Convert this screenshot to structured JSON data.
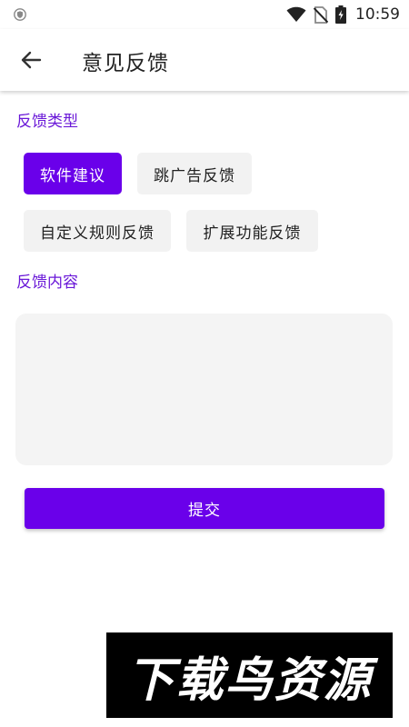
{
  "status_bar": {
    "time": "10:59",
    "icons": [
      "shield-icon",
      "wifi-icon",
      "no-sim-icon",
      "battery-charging-icon"
    ]
  },
  "app_bar": {
    "back_icon": "arrow-left-icon",
    "title": "意见反馈"
  },
  "feedback_type": {
    "label": "反馈类型",
    "options": [
      {
        "label": "软件建议",
        "selected": true
      },
      {
        "label": "跳广告反馈",
        "selected": false
      },
      {
        "label": "自定义规则反馈",
        "selected": false
      },
      {
        "label": "扩展功能反馈",
        "selected": false
      }
    ]
  },
  "feedback_content": {
    "label": "反馈内容",
    "value": "",
    "placeholder": ""
  },
  "submit": {
    "label": "提交"
  },
  "watermark": {
    "text": "下载鸟资源"
  },
  "colors": {
    "accent": "#6a00ea",
    "section_label": "#6a18d8",
    "chip_bg": "#f2f2f2",
    "input_bg": "#f4f4f4"
  }
}
